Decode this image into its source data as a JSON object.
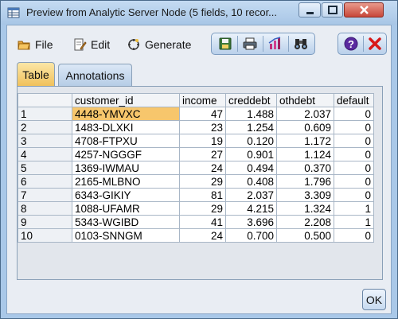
{
  "window": {
    "title": "Preview from Analytic Server Node (5 fields, 10 recor..."
  },
  "menu": {
    "file": "File",
    "edit": "Edit",
    "generate": "Generate"
  },
  "toolbar": {
    "icons": [
      "save-icon",
      "print-icon",
      "chart-icon",
      "binoculars-icon",
      "help-icon",
      "close-icon"
    ]
  },
  "tabs": {
    "table": "Table",
    "annotations": "Annotations"
  },
  "table": {
    "columns": [
      "",
      "customer_id",
      "income",
      "creddebt",
      "othdebt",
      "default"
    ],
    "rows": [
      [
        "1",
        "4448-YMVXC",
        "47",
        "1.488",
        "2.037",
        "0"
      ],
      [
        "2",
        "1483-DLXKI",
        "23",
        "1.254",
        "0.609",
        "0"
      ],
      [
        "3",
        "4708-FTPXU",
        "19",
        "0.120",
        "1.172",
        "0"
      ],
      [
        "4",
        "4257-NGGGF",
        "27",
        "0.901",
        "1.124",
        "0"
      ],
      [
        "5",
        "1369-IWMAU",
        "24",
        "0.494",
        "0.370",
        "0"
      ],
      [
        "6",
        "2165-MLBNO",
        "29",
        "0.408",
        "1.796",
        "0"
      ],
      [
        "7",
        "6343-GIKIY",
        "81",
        "2.037",
        "3.309",
        "0"
      ],
      [
        "8",
        "1088-UFAMR",
        "29",
        "4.215",
        "1.324",
        "1"
      ],
      [
        "9",
        "5343-WGIBD",
        "41",
        "3.696",
        "2.208",
        "1"
      ],
      [
        "10",
        "0103-SNNGM",
        "24",
        "0.700",
        "0.500",
        "0"
      ]
    ],
    "selected_cell": "4448-YMVXC"
  },
  "buttons": {
    "ok": "OK"
  },
  "colors": {
    "title_bar": "#a8c6e6",
    "selected_cell": "#f7c66c",
    "active_tab": "#f0c15c",
    "close_button": "#c8473a"
  }
}
